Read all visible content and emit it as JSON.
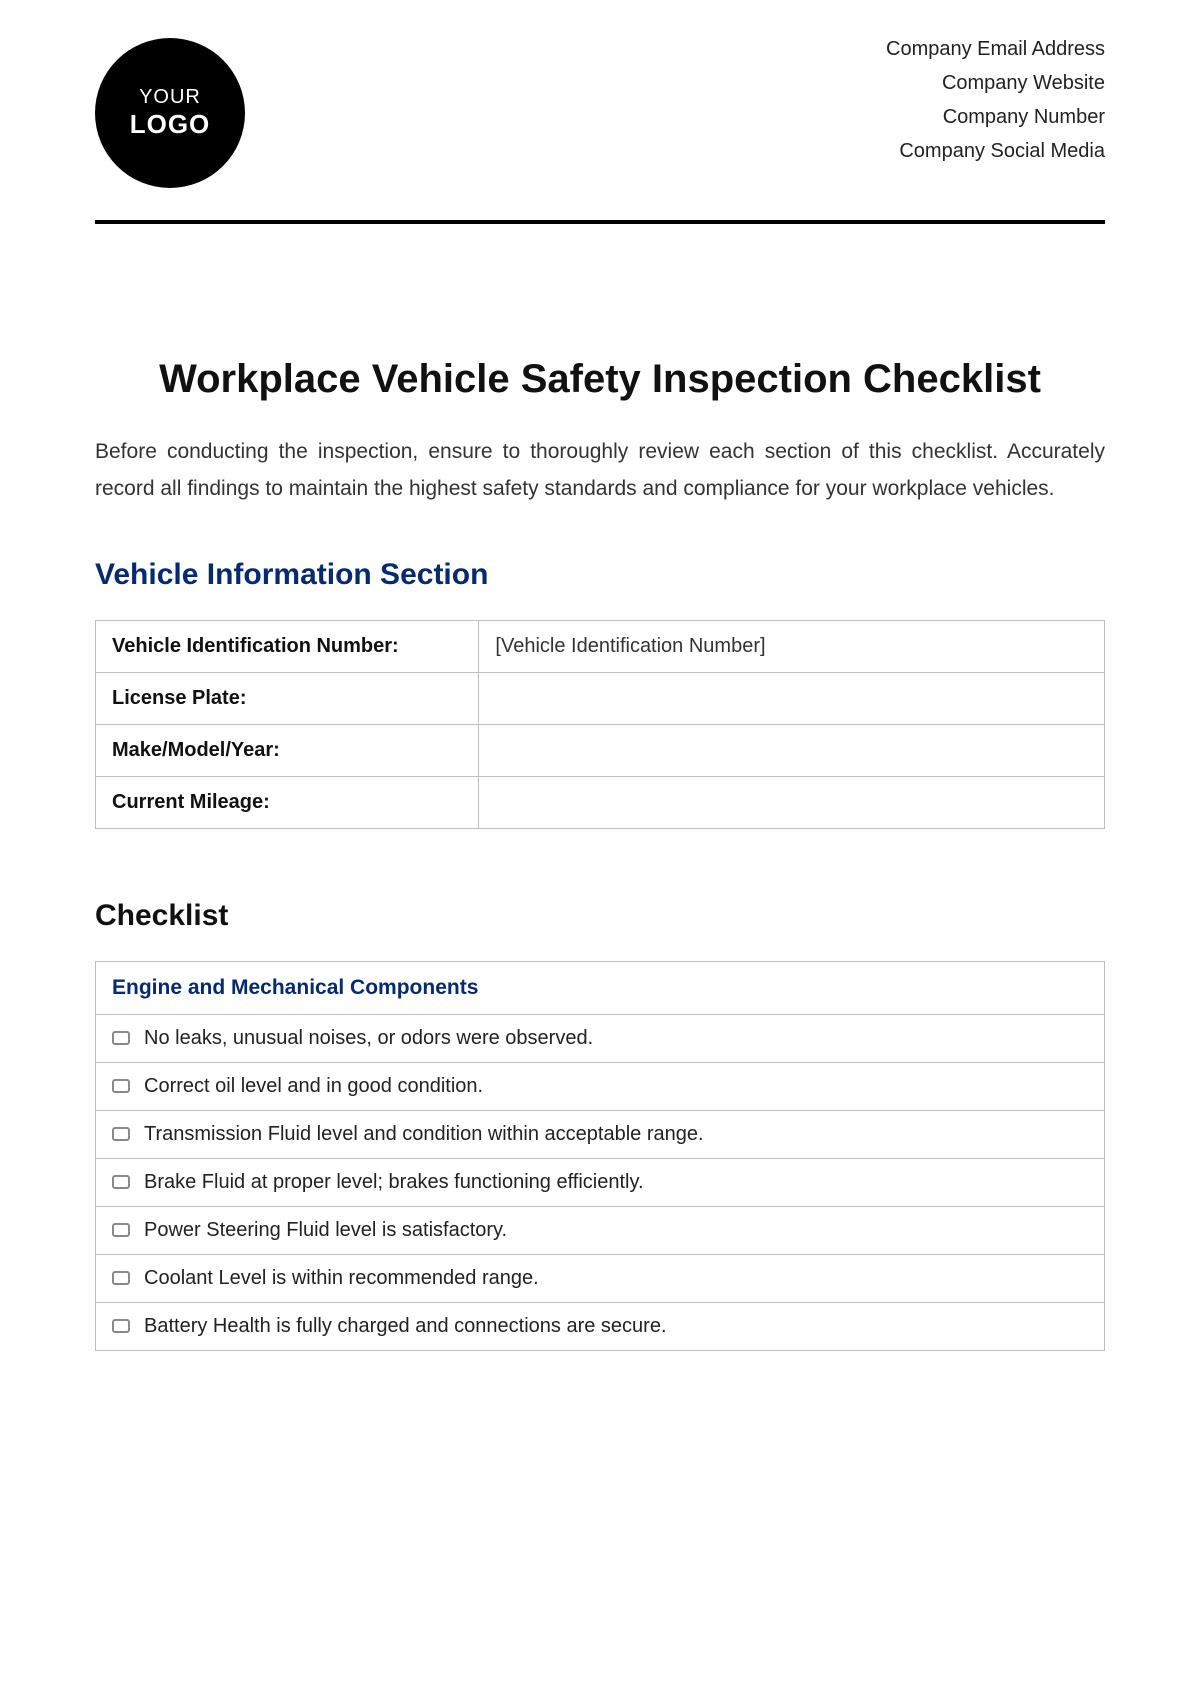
{
  "header": {
    "logo_line1": "YOUR",
    "logo_line2": "LOGO",
    "meta": [
      "Company Email Address",
      "Company Website",
      "Company Number",
      "Company Social Media"
    ]
  },
  "title": "Workplace Vehicle Safety Inspection Checklist",
  "intro": "Before conducting the inspection, ensure to thoroughly review each section of this checklist. Accurately record all findings to maintain the highest safety standards and compliance for your workplace vehicles.",
  "vehicle_info": {
    "heading": "Vehicle Information Section",
    "rows": [
      {
        "label": "Vehicle Identification Number:",
        "value": "[Vehicle Identification Number]"
      },
      {
        "label": "License Plate:",
        "value": ""
      },
      {
        "label": "Make/Model/Year:",
        "value": ""
      },
      {
        "label": "Current Mileage:",
        "value": ""
      }
    ]
  },
  "checklist": {
    "heading": "Checklist",
    "group_title": "Engine and Mechanical Components",
    "items": [
      "No leaks, unusual noises, or odors were observed.",
      "Correct oil level and in good condition.",
      "Transmission Fluid level and condition within acceptable range.",
      "Brake Fluid at proper level; brakes functioning efficiently.",
      "Power Steering Fluid level is satisfactory.",
      "Coolant Level is within recommended range.",
      "Battery Health is fully charged and connections are secure."
    ]
  }
}
